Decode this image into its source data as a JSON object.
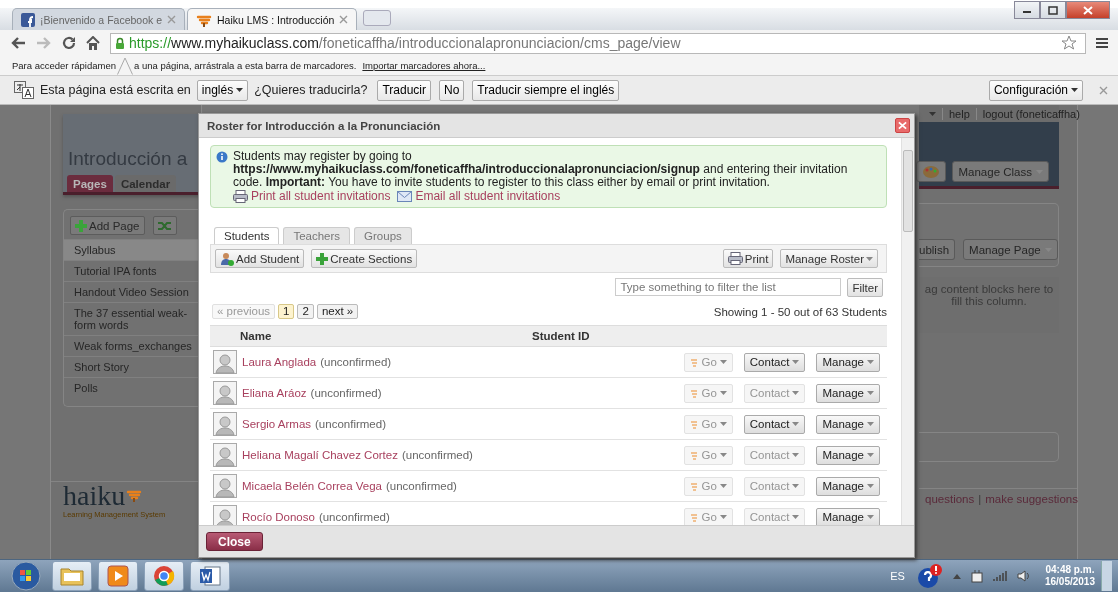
{
  "browser": {
    "tabs": [
      {
        "title": "¡Bienvenido a Facebook e",
        "kind": "social",
        "selected": false
      },
      {
        "title": "Haiku LMS : Introducción",
        "kind": "haiku",
        "selected": true
      }
    ],
    "address": {
      "scheme": "https://",
      "host": "www.myhaikuclass.com",
      "path": "/foneticaffha/introduccionalapronunciacion/cms_page/view"
    },
    "bookmarks_bar": {
      "hint_start": "Para acceder rápidamen",
      "hint_end": "a una página, arrástrala a esta barra de marcadores.",
      "import_link": "Importar marcadores ahora..."
    },
    "translate_bar": {
      "prefix": "Esta página está escrita en",
      "language": "inglés",
      "question": "¿Quieres traducirla?",
      "buttons": [
        "Traducir",
        "No",
        "Traducir siempre el inglés"
      ],
      "settings": "Configuración"
    }
  },
  "page": {
    "title": "Introducción a",
    "tabs": [
      {
        "label": "Pages",
        "selected": true
      },
      {
        "label": "Calendar",
        "selected": false
      }
    ],
    "add_page": "Add Page",
    "pages": [
      {
        "title": "Syllabus",
        "selected": true
      },
      {
        "title": "Tutorial IPA fonts",
        "selected": false
      },
      {
        "title": "Handout Video Session",
        "selected": false
      },
      {
        "title": "The 37 essential weak-form words",
        "selected": false
      },
      {
        "title": "Weak forms_exchanges",
        "selected": false
      },
      {
        "title": "Short Story",
        "selected": false
      },
      {
        "title": "Polls",
        "selected": false
      }
    ],
    "logo": "haiku",
    "logo_tagline": "Learning Management System",
    "top_links": [
      "help",
      "logout (foneticaffha)"
    ],
    "manage_class": "Manage Class",
    "publish": "ublish",
    "manage_page": "Manage Page",
    "drop_hint": "ag content blocks here to fill this column.",
    "footer_links": [
      "questions",
      "make suggestions"
    ],
    "footer_separator": "|"
  },
  "dialog": {
    "title": "Roster for Introducción a la Pronunciación",
    "notice": "Students may register by going to **https://www.myhaikuclass.com/foneticaffha/introduccionalapronunciacion/signup** and entering their invitation code. **Important:** You have to invite students to register to this class either by email or print invitation.",
    "notice_links": [
      {
        "label": "Print all student invitations",
        "kind": "print"
      },
      {
        "label": "Email all student invitations",
        "kind": "email"
      }
    ],
    "tabs": [
      {
        "label": "Students",
        "selected": true
      },
      {
        "label": "Teachers",
        "selected": false
      },
      {
        "label": "Groups",
        "selected": false
      }
    ],
    "toolbar_left": [
      {
        "label": "Add Student",
        "kind": "add-user"
      },
      {
        "label": "Create Sections",
        "kind": "plus"
      }
    ],
    "toolbar_right": [
      {
        "label": "Print",
        "kind": "print"
      },
      {
        "label": "Manage Roster",
        "kind": "menu"
      }
    ],
    "filter": {
      "placeholder": "Type something to filter the list",
      "button": "Filter"
    },
    "pagination": [
      {
        "label": "« previous",
        "disabled": true,
        "selected": false
      },
      {
        "label": "1",
        "disabled": false,
        "selected": true
      },
      {
        "label": "2",
        "disabled": false,
        "selected": false
      },
      {
        "label": "next »",
        "disabled": false,
        "selected": false
      }
    ],
    "summary": "Showing 1 - 50 out of 63 Students",
    "columns": [
      "Name",
      "Student ID"
    ],
    "students": [
      {
        "name": "Laura Anglada",
        "status": "(unconfirmed)",
        "go": "Go",
        "go_disabled": true,
        "contact": "Contact",
        "contact_disabled": false,
        "manage": "Manage"
      },
      {
        "name": "Eliana Aráoz",
        "status": "(unconfirmed)",
        "go": "Go",
        "go_disabled": true,
        "contact": "Contact",
        "contact_disabled": true,
        "manage": "Manage"
      },
      {
        "name": "Sergio Armas",
        "status": "(unconfirmed)",
        "go": "Go",
        "go_disabled": true,
        "contact": "Contact",
        "contact_disabled": false,
        "manage": "Manage"
      },
      {
        "name": "Heliana Magalí Chavez Cortez",
        "status": "(unconfirmed)",
        "go": "Go",
        "go_disabled": true,
        "contact": "Contact",
        "contact_disabled": true,
        "manage": "Manage"
      },
      {
        "name": "Micaela Belén Correa Vega",
        "status": "(unconfirmed)",
        "go": "Go",
        "go_disabled": true,
        "contact": "Contact",
        "contact_disabled": true,
        "manage": "Manage"
      },
      {
        "name": "Rocío Donoso",
        "status": "(unconfirmed)",
        "go": "Go",
        "go_disabled": true,
        "contact": "Contact",
        "contact_disabled": true,
        "manage": "Manage"
      }
    ],
    "close": "Close"
  },
  "taskbar": {
    "apps": [
      {
        "kind": "folder"
      },
      {
        "kind": "media"
      },
      {
        "kind": "browser"
      },
      {
        "kind": "document"
      }
    ],
    "language": "ES",
    "time": "04:48 p.m.",
    "date": "16/05/2013"
  }
}
